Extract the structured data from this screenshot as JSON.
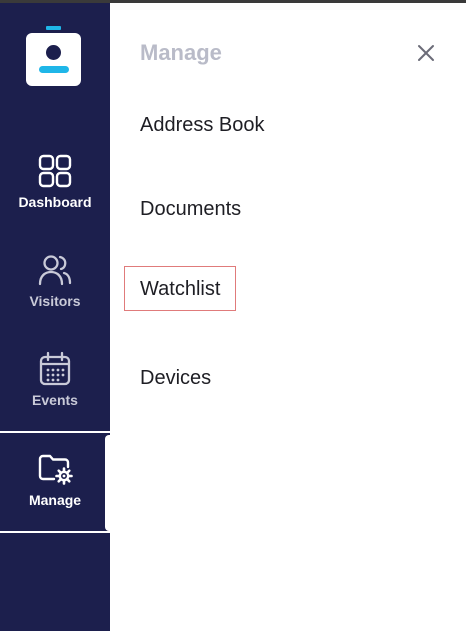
{
  "sidebar": {
    "items": [
      {
        "label": "Dashboard",
        "icon": "dashboard-grid-icon"
      },
      {
        "label": "Visitors",
        "icon": "visitors-icon"
      },
      {
        "label": "Events",
        "icon": "calendar-icon"
      },
      {
        "label": "Manage",
        "icon": "folder-gear-icon"
      }
    ],
    "active": "Manage"
  },
  "panel": {
    "title": "Manage",
    "close_icon": "close-icon",
    "items": [
      {
        "label": "Address Book"
      },
      {
        "label": "Documents"
      },
      {
        "label": "Watchlist"
      },
      {
        "label": "Devices"
      }
    ],
    "highlighted": "Watchlist"
  },
  "colors": {
    "sidebar_bg": "#1c1f4d",
    "accent": "#1fb6e8",
    "highlight_border": "#e07b7b",
    "title_muted": "#b9bbc8"
  }
}
